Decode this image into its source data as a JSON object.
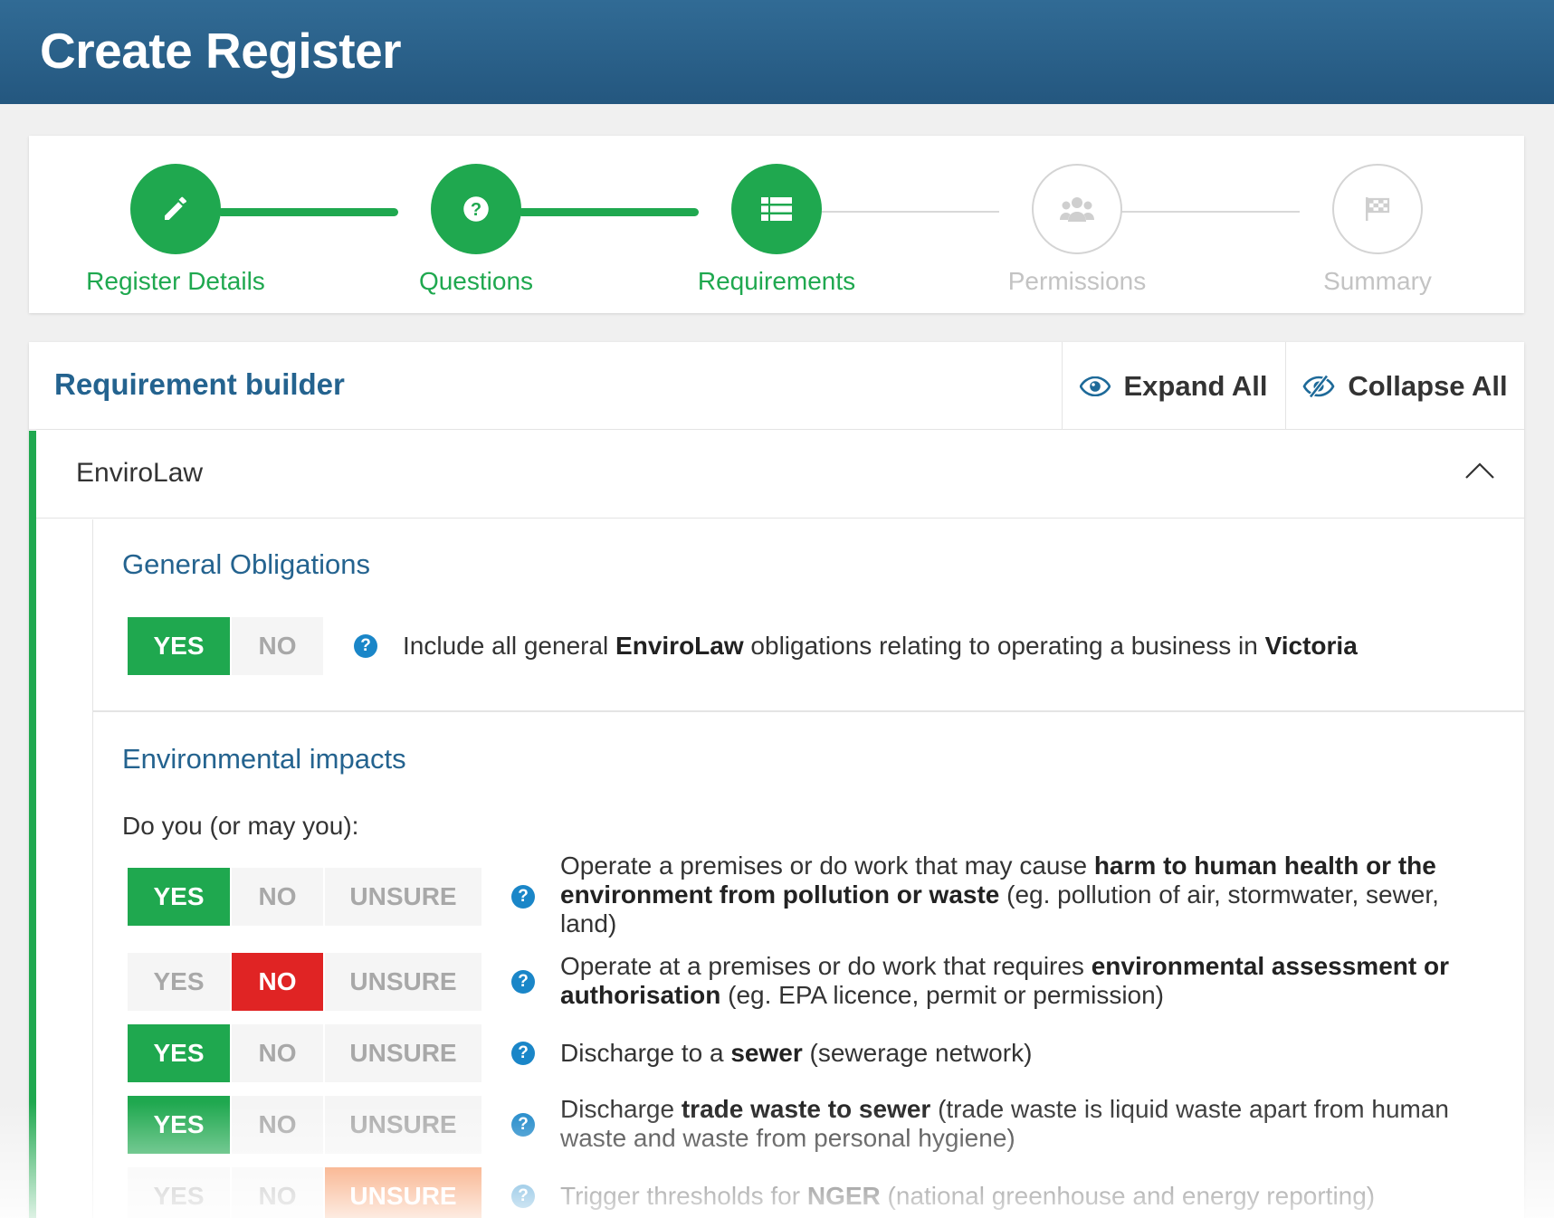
{
  "header": {
    "title": "Create Register"
  },
  "stepper": {
    "steps": [
      {
        "label": "Register Details",
        "icon": "pencil-icon",
        "state": "complete"
      },
      {
        "label": "Questions",
        "icon": "question-icon",
        "state": "complete"
      },
      {
        "label": "Requirements",
        "icon": "list-icon",
        "state": "current"
      },
      {
        "label": "Permissions",
        "icon": "users-icon",
        "state": "upcoming"
      },
      {
        "label": "Summary",
        "icon": "flag-icon",
        "state": "upcoming"
      }
    ]
  },
  "builder": {
    "title": "Requirement builder",
    "expand_label": "Expand All",
    "collapse_label": "Collapse All",
    "section": "EnviroLaw",
    "groups": [
      {
        "title": "General Obligations",
        "questions": [
          {
            "answer": "YES",
            "options": [
              "YES",
              "NO"
            ],
            "parts": [
              "Include all general ",
              "EnviroLaw",
              " obligations relating to operating a business in ",
              "Victoria",
              ""
            ]
          }
        ]
      },
      {
        "title": "Environmental impacts",
        "intro": "Do you (or may you):",
        "questions": [
          {
            "answer": "YES",
            "options": [
              "YES",
              "NO",
              "UNSURE"
            ],
            "parts": [
              "Operate a premises or do work that may cause ",
              "harm to human health or the environment from pollution or waste",
              " (eg. pollution of air, stormwater, sewer, land)"
            ]
          },
          {
            "answer": "NO",
            "options": [
              "YES",
              "NO",
              "UNSURE"
            ],
            "parts": [
              "Operate at a premises or do work that requires ",
              "environmental assessment or authorisation",
              " (eg. EPA licence, permit or permission)"
            ]
          },
          {
            "answer": "YES",
            "options": [
              "YES",
              "NO",
              "UNSURE"
            ],
            "parts": [
              "Discharge to a ",
              "sewer",
              " (sewerage network)"
            ]
          },
          {
            "answer": "YES",
            "options": [
              "YES",
              "NO",
              "UNSURE"
            ],
            "parts": [
              "Discharge ",
              "trade waste to sewer",
              " (trade waste is liquid waste apart from human waste and waste from personal hygiene)"
            ]
          },
          {
            "answer": "UNSURE",
            "options": [
              "YES",
              "NO",
              "UNSURE"
            ],
            "parts": [
              "Trigger thresholds for ",
              "NGER",
              " (national greenhouse and energy reporting)"
            ]
          }
        ]
      }
    ]
  },
  "colors": {
    "accent": "#1fa84f",
    "brand": "#24638f",
    "no": "#e02424",
    "unsure": "#f47a36",
    "help": "#1a86c8"
  }
}
